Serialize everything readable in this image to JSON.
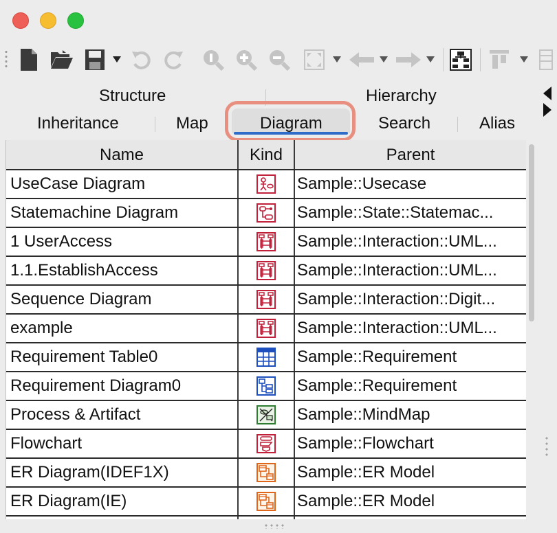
{
  "tabs": {
    "row1": [
      "Structure",
      "Hierarchy"
    ],
    "row2": [
      "Inheritance",
      "Map",
      "Diagram",
      "Search",
      "Alias"
    ],
    "active": "Diagram"
  },
  "toolbar": {
    "icons": [
      "new-file-icon",
      "open-folder-icon",
      "save-icon",
      "dropdown-icon",
      "undo-icon",
      "redo-icon",
      "find-icon",
      "zoom-in-icon",
      "zoom-out-icon",
      "fit-window-icon",
      "dropdown-icon",
      "back-arrow-icon",
      "dropdown-icon",
      "forward-arrow-icon",
      "dropdown-icon",
      "hierarchy-icon",
      "align-icon",
      "dropdown-icon"
    ]
  },
  "table": {
    "columns": [
      "Name",
      "Kind",
      "Parent"
    ],
    "rows": [
      {
        "name": "UseCase Diagram",
        "kind": "usecase",
        "parent": "Sample::Usecase"
      },
      {
        "name": "Statemachine Diagram",
        "kind": "statemachine",
        "parent": "Sample::State::Statemac..."
      },
      {
        "name": "1 UserAccess",
        "kind": "sequence",
        "parent": "Sample::Interaction::UML..."
      },
      {
        "name": "1.1.EstablishAccess",
        "kind": "sequence",
        "parent": "Sample::Interaction::UML..."
      },
      {
        "name": "Sequence Diagram",
        "kind": "sequence",
        "parent": "Sample::Interaction::Digit..."
      },
      {
        "name": "example",
        "kind": "sequence",
        "parent": "Sample::Interaction::UML..."
      },
      {
        "name": "Requirement Table0",
        "kind": "req-table",
        "parent": "Sample::Requirement"
      },
      {
        "name": "Requirement Diagram0",
        "kind": "req-diagram",
        "parent": "Sample::Requirement"
      },
      {
        "name": "Process & Artifact",
        "kind": "mindmap",
        "parent": "Sample::MindMap"
      },
      {
        "name": "Flowchart",
        "kind": "flowchart",
        "parent": "Sample::Flowchart"
      },
      {
        "name": "ER Diagram(IDEF1X)",
        "kind": "er",
        "parent": "Sample::ER Model"
      },
      {
        "name": "ER Diagram(IE)",
        "kind": "er",
        "parent": "Sample::ER Model"
      },
      {
        "name": "",
        "kind": "",
        "parent": ""
      }
    ]
  },
  "colors": {
    "uml_red": "#c0203a",
    "req_blue": "#1e4fbf",
    "mindmap_green": "#2e7d32",
    "er_orange": "#e0661c",
    "tab_accent": "#2d6cc9",
    "highlight": "#e88f7f"
  }
}
